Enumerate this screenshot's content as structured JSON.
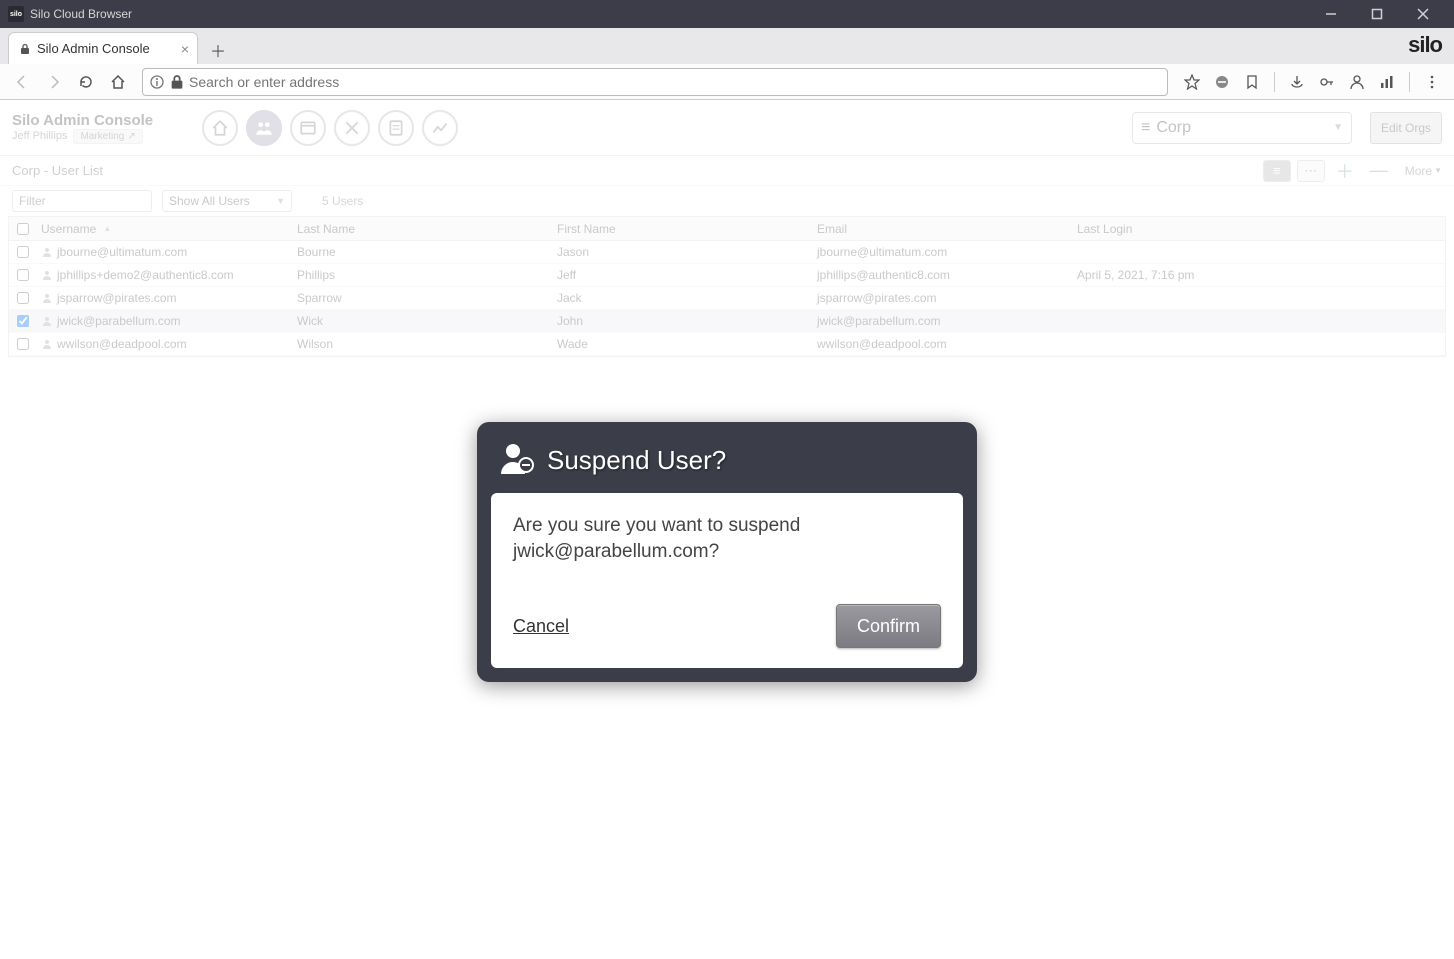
{
  "window": {
    "title": "Silo Cloud Browser"
  },
  "tab": {
    "label": "Silo Admin Console"
  },
  "addr": {
    "placeholder": "Search or enter address"
  },
  "brand": {
    "logo": "silo"
  },
  "admin": {
    "title": "Silo Admin Console",
    "user": "Jeff Phillips",
    "org_badge": "Marketing",
    "org_select": "Corp",
    "edit_orgs": "Edit Orgs"
  },
  "subheader": {
    "breadcrumb": "Corp - User List",
    "more": "More"
  },
  "filter": {
    "placeholder": "Filter",
    "show_label": "Show All Users",
    "count": "5 Users"
  },
  "table": {
    "headers": {
      "username": "Username",
      "lastname": "Last Name",
      "firstname": "First Name",
      "email": "Email",
      "lastlogin": "Last Login"
    },
    "rows": [
      {
        "checked": false,
        "username": "jbourne@ultimatum.com",
        "lastname": "Bourne",
        "firstname": "Jason",
        "email": "jbourne@ultimatum.com",
        "lastlogin": ""
      },
      {
        "checked": false,
        "username": "jphillips+demo2@authentic8.com",
        "lastname": "Phillips",
        "firstname": "Jeff",
        "email": "jphillips@authentic8.com",
        "lastlogin": "April 5, 2021, 7:16 pm"
      },
      {
        "checked": false,
        "username": "jsparrow@pirates.com",
        "lastname": "Sparrow",
        "firstname": "Jack",
        "email": "jsparrow@pirates.com",
        "lastlogin": ""
      },
      {
        "checked": true,
        "username": "jwick@parabellum.com",
        "lastname": "Wick",
        "firstname": "John",
        "email": "jwick@parabellum.com",
        "lastlogin": ""
      },
      {
        "checked": false,
        "username": "wwilson@deadpool.com",
        "lastname": "Wilson",
        "firstname": "Wade",
        "email": "wwilson@deadpool.com",
        "lastlogin": ""
      }
    ]
  },
  "modal": {
    "title": "Suspend User?",
    "message": "Are you sure you want to suspend jwick@parabellum.com?",
    "cancel": "Cancel",
    "confirm": "Confirm"
  }
}
